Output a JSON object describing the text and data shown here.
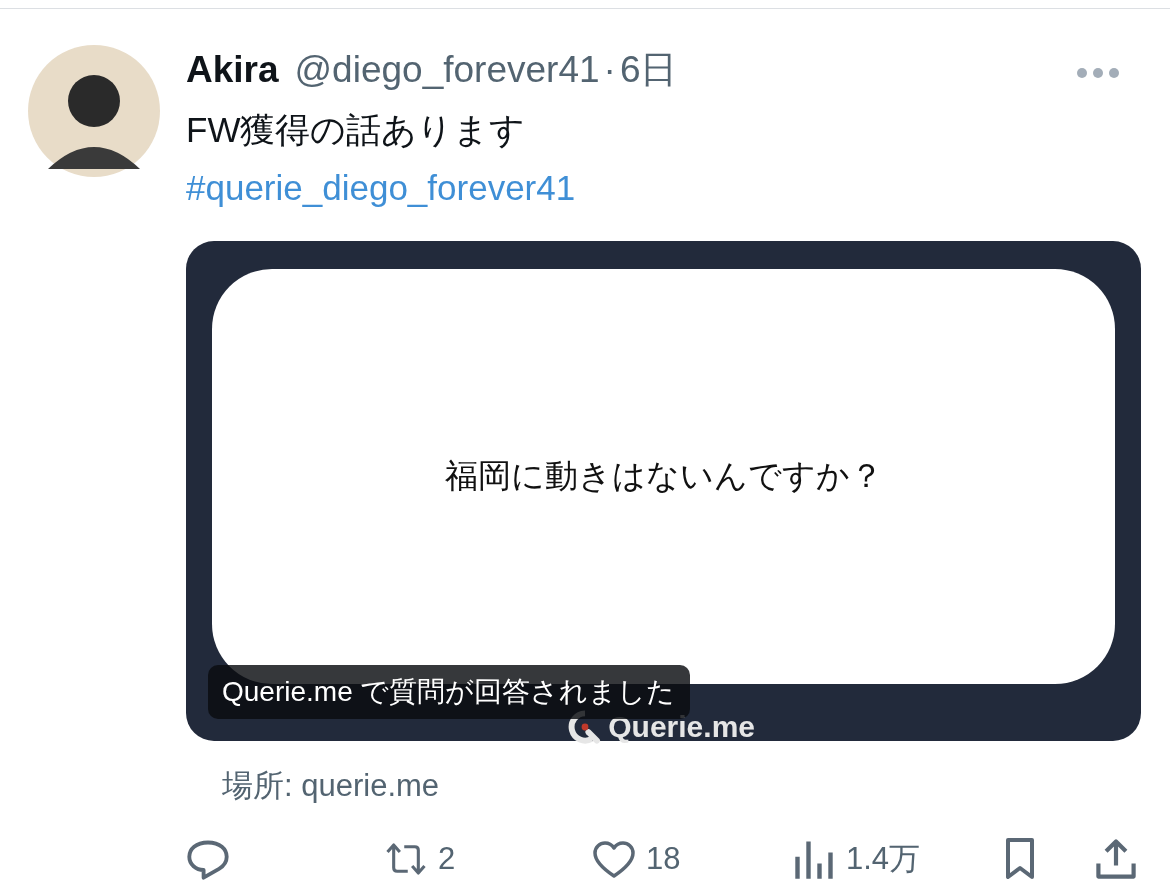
{
  "post": {
    "author": "Akira",
    "handle": "@diego_forever41",
    "separator": "·",
    "time": "6日",
    "text": "FW獲得の話あります",
    "hashtag": "#querie_diego_forever41"
  },
  "card": {
    "question": "福岡に動きはないんですか？",
    "brand": "Querie.me",
    "caption": "Querie.me で質問が回答されました"
  },
  "location": "場所: querie.me",
  "actions": [
    {
      "kind": "reply"
    },
    {
      "kind": "repost",
      "count": "2"
    },
    {
      "kind": "like",
      "count": "18"
    },
    {
      "kind": "views",
      "count": "1.4万"
    },
    {
      "kind": "bookmark"
    },
    {
      "kind": "share"
    }
  ]
}
